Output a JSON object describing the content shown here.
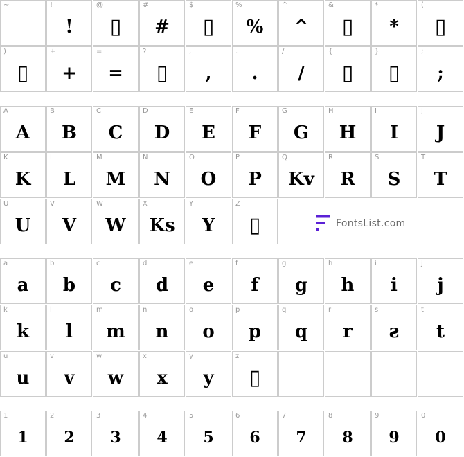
{
  "logo_text": "FontsList.com",
  "colors": {
    "border": "#cccccc",
    "label": "#999999",
    "brand_accent": "#5b21d6",
    "brand_text": "#6b6b6b"
  },
  "missing_glyph": "▯",
  "sections": [
    {
      "rows": [
        [
          {
            "label": "~",
            "glyph": "▯",
            "missing": true,
            "hide_glyph": true
          },
          {
            "label": "!",
            "glyph": "!"
          },
          {
            "label": "@",
            "glyph": "▯",
            "missing": true
          },
          {
            "label": "#",
            "glyph": "#"
          },
          {
            "label": "$",
            "glyph": "▯",
            "missing": true
          },
          {
            "label": "%",
            "glyph": "%"
          },
          {
            "label": "^",
            "glyph": "^"
          },
          {
            "label": "&",
            "glyph": "▯",
            "missing": true
          },
          {
            "label": "*",
            "glyph": "*"
          },
          {
            "label": "(",
            "glyph": "▯",
            "missing": true
          }
        ],
        [
          {
            "label": ")",
            "glyph": "▯",
            "missing": true
          },
          {
            "label": "+",
            "glyph": "+"
          },
          {
            "label": "=",
            "glyph": "="
          },
          {
            "label": "?",
            "glyph": "▯",
            "missing": true
          },
          {
            "label": ",",
            "glyph": ","
          },
          {
            "label": ".",
            "glyph": "."
          },
          {
            "label": "/",
            "glyph": "/"
          },
          {
            "label": "{",
            "glyph": "▯",
            "missing": true
          },
          {
            "label": "}",
            "glyph": "▯",
            "missing": true
          },
          {
            "label": ";",
            "glyph": ";"
          }
        ]
      ]
    },
    {
      "rows": [
        [
          {
            "label": "A",
            "glyph": "A"
          },
          {
            "label": "B",
            "glyph": "B"
          },
          {
            "label": "C",
            "glyph": "C"
          },
          {
            "label": "D",
            "glyph": "D"
          },
          {
            "label": "E",
            "glyph": "E"
          },
          {
            "label": "F",
            "glyph": "F"
          },
          {
            "label": "G",
            "glyph": "G"
          },
          {
            "label": "H",
            "glyph": "H"
          },
          {
            "label": "I",
            "glyph": "I"
          },
          {
            "label": "J",
            "glyph": "J"
          }
        ],
        [
          {
            "label": "K",
            "glyph": "K"
          },
          {
            "label": "L",
            "glyph": "L"
          },
          {
            "label": "M",
            "glyph": "M"
          },
          {
            "label": "N",
            "glyph": "N"
          },
          {
            "label": "O",
            "glyph": "O"
          },
          {
            "label": "P",
            "glyph": "P"
          },
          {
            "label": "Q",
            "glyph": "Kv"
          },
          {
            "label": "R",
            "glyph": "R"
          },
          {
            "label": "S",
            "glyph": "S"
          },
          {
            "label": "T",
            "glyph": "T"
          }
        ],
        [
          {
            "label": "U",
            "glyph": "U"
          },
          {
            "label": "V",
            "glyph": "V"
          },
          {
            "label": "W",
            "glyph": "W"
          },
          {
            "label": "X",
            "glyph": "Ks"
          },
          {
            "label": "Y",
            "glyph": "Y"
          },
          {
            "label": "Z",
            "glyph": "▯",
            "missing": true
          }
        ]
      ]
    },
    {
      "rows": [
        [
          {
            "label": "a",
            "glyph": "a"
          },
          {
            "label": "b",
            "glyph": "b"
          },
          {
            "label": "c",
            "glyph": "c"
          },
          {
            "label": "d",
            "glyph": "d"
          },
          {
            "label": "e",
            "glyph": "e"
          },
          {
            "label": "f",
            "glyph": "f"
          },
          {
            "label": "g",
            "glyph": "g"
          },
          {
            "label": "h",
            "glyph": "h"
          },
          {
            "label": "i",
            "glyph": "i"
          },
          {
            "label": "j",
            "glyph": "j"
          }
        ],
        [
          {
            "label": "k",
            "glyph": "k"
          },
          {
            "label": "l",
            "glyph": "l"
          },
          {
            "label": "m",
            "glyph": "m"
          },
          {
            "label": "n",
            "glyph": "n"
          },
          {
            "label": "o",
            "glyph": "o"
          },
          {
            "label": "p",
            "glyph": "p"
          },
          {
            "label": "q",
            "glyph": "q"
          },
          {
            "label": "r",
            "glyph": "r"
          },
          {
            "label": "s",
            "glyph": "ƨ"
          },
          {
            "label": "t",
            "glyph": "t"
          }
        ],
        [
          {
            "label": "u",
            "glyph": "u"
          },
          {
            "label": "v",
            "glyph": "v"
          },
          {
            "label": "w",
            "glyph": "w"
          },
          {
            "label": "x",
            "glyph": "x"
          },
          {
            "label": "y",
            "glyph": "y"
          },
          {
            "label": "z",
            "glyph": "▯",
            "missing": true
          },
          {
            "label": "",
            "glyph": ""
          },
          {
            "label": "",
            "glyph": ""
          },
          {
            "label": "",
            "glyph": ""
          },
          {
            "label": "",
            "glyph": ""
          }
        ]
      ]
    },
    {
      "rows": [
        [
          {
            "label": "1",
            "glyph": "1",
            "digit": true
          },
          {
            "label": "2",
            "glyph": "2",
            "digit": true
          },
          {
            "label": "3",
            "glyph": "3",
            "digit": true
          },
          {
            "label": "4",
            "glyph": "4",
            "digit": true
          },
          {
            "label": "5",
            "glyph": "5",
            "digit": true
          },
          {
            "label": "6",
            "glyph": "6",
            "digit": true
          },
          {
            "label": "7",
            "glyph": "7",
            "digit": true
          },
          {
            "label": "8",
            "glyph": "8",
            "digit": true
          },
          {
            "label": "9",
            "glyph": "9",
            "digit": true
          },
          {
            "label": "0",
            "glyph": "0",
            "digit": true
          }
        ]
      ]
    }
  ]
}
